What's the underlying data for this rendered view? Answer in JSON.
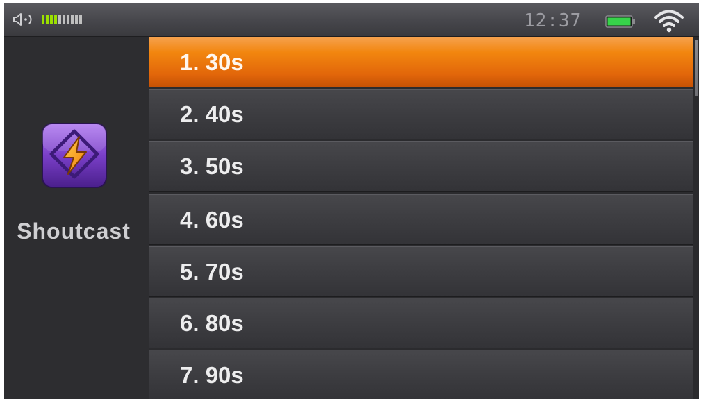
{
  "status_bar": {
    "time": "12:37",
    "volume_level": 4,
    "volume_segments": 10,
    "battery_color": "#37d34a",
    "accent_volume_color": "#9be000",
    "icons": [
      "speaker-icon",
      "battery-icon",
      "wifi-icon"
    ]
  },
  "sidebar": {
    "app_name": "Shoutcast",
    "app_icon": "shoutcast-lightning-icon",
    "app_icon_color": "#7a3fc8"
  },
  "list": {
    "selected_index": 0,
    "selected_color": "#f2860f",
    "items": [
      {
        "label": "1. 30s"
      },
      {
        "label": "2. 40s"
      },
      {
        "label": "3. 50s"
      },
      {
        "label": "4. 60s"
      },
      {
        "label": "5. 70s"
      },
      {
        "label": "6. 80s"
      },
      {
        "label": "7. 90s"
      }
    ]
  }
}
